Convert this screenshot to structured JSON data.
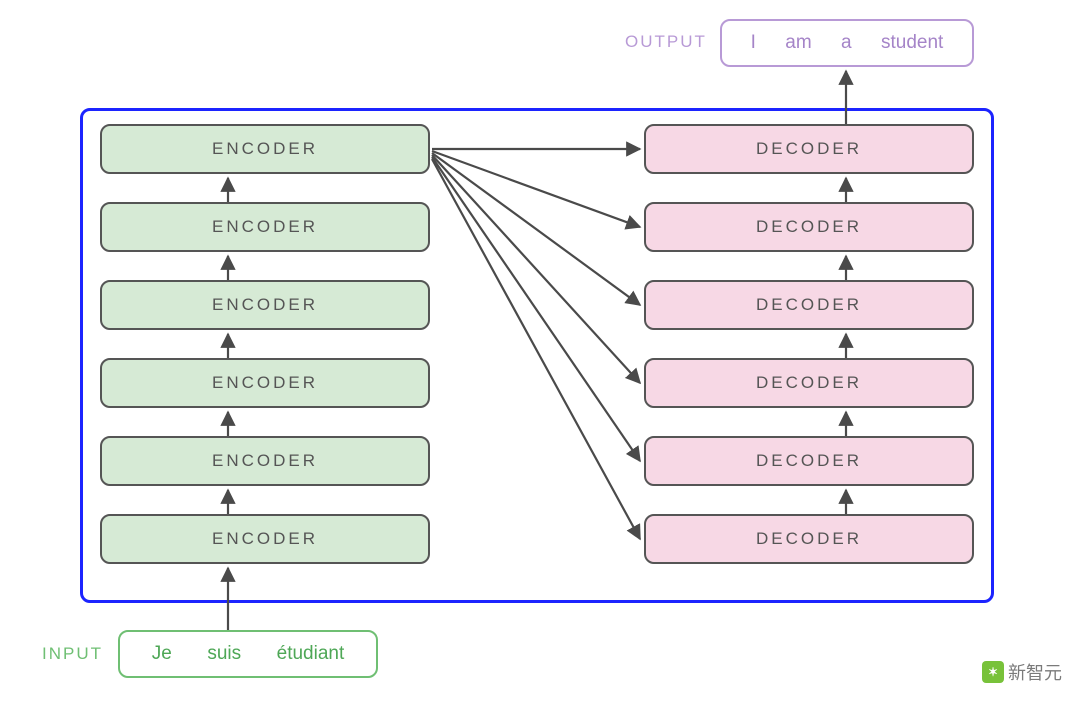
{
  "labels": {
    "input": "INPUT",
    "output": "OUTPUT",
    "encoder": "ENCODER",
    "decoder": "DECODER"
  },
  "input_tokens": [
    "Je",
    "suis",
    "étudiant"
  ],
  "output_tokens": [
    "I",
    "am",
    "a",
    "student"
  ],
  "stack": {
    "encoders": 6,
    "decoders": 6
  },
  "colors": {
    "encoder_fill": "#d6ead5",
    "decoder_fill": "#f7d8e5",
    "frame": "#1c24ff",
    "input_accent": "#6fbf73",
    "output_accent": "#b89ad6",
    "arrow": "#4a4a4a"
  },
  "watermark": "新智元"
}
